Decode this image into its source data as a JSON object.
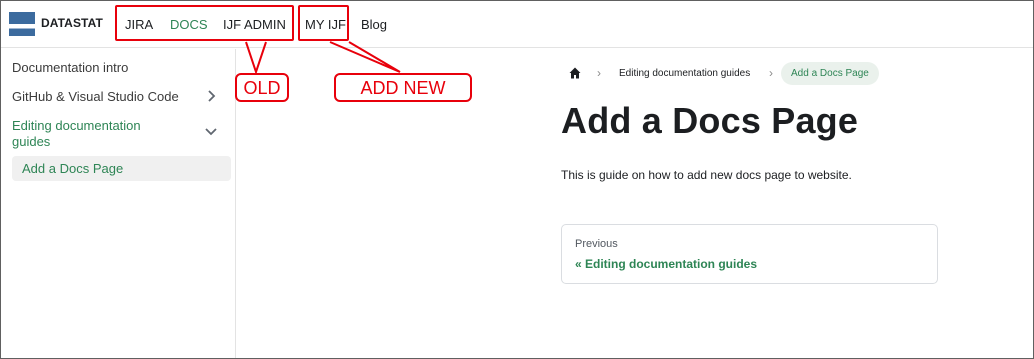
{
  "navbar": {
    "brand": "DATASTAT",
    "logo_text": "DATASTAT",
    "links": [
      {
        "label": "JIRA",
        "active": false
      },
      {
        "label": "DOCS",
        "active": true
      },
      {
        "label": "IJF ADMIN",
        "active": false
      },
      {
        "label": "MY IJF",
        "active": false
      },
      {
        "label": "Blog",
        "active": false
      }
    ]
  },
  "sidebar": {
    "items": [
      {
        "label": "Documentation intro",
        "icon": null
      },
      {
        "label": "GitHub & Visual Studio Code",
        "icon": "chevron-right-icon"
      },
      {
        "label": "Editing documentation guides",
        "icon": "chevron-down-icon",
        "expanded": true
      },
      {
        "label": "Add a Docs Page",
        "active": true
      }
    ]
  },
  "breadcrumbs": {
    "home_icon": "home-icon",
    "items": [
      "Editing documentation guides",
      "Add a Docs Page"
    ]
  },
  "main": {
    "title": "Add a Docs Page",
    "description": "This is guide on how to add new docs page to website.",
    "pager": {
      "sublabel": "Previous",
      "label": "« Editing documentation guides"
    }
  },
  "annotations": {
    "old_label": "OLD",
    "new_label": "ADD NEW",
    "color": "#e8000b"
  },
  "colors": {
    "accent": "#2e8555",
    "logo_blue": "#3c6b9e",
    "active_bg": "#f0f0f0"
  }
}
